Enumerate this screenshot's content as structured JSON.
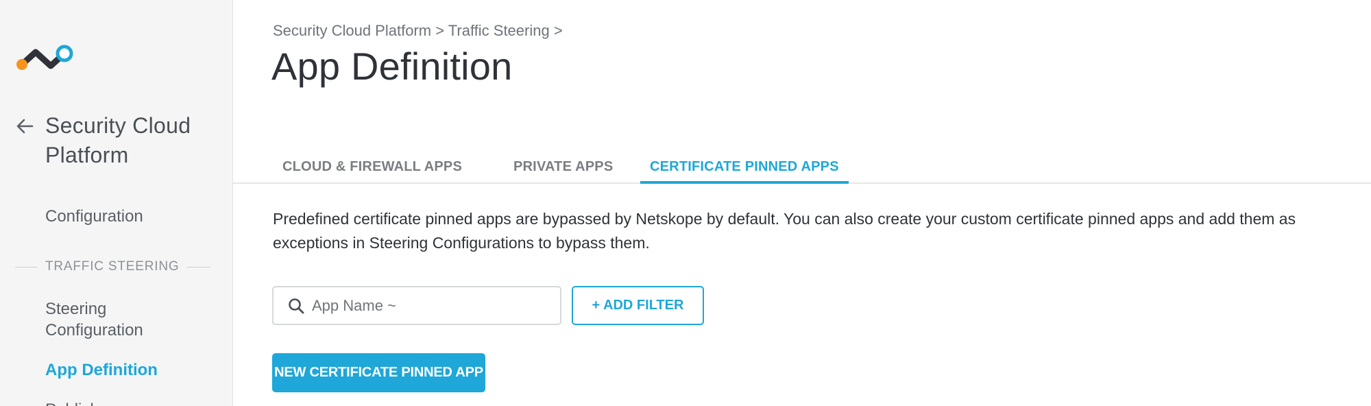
{
  "sidebar": {
    "back_title": "Security Cloud Platform",
    "items": [
      {
        "label": "Configuration"
      },
      {
        "label": "Steering Configuration"
      },
      {
        "label": "App Definition"
      },
      {
        "label": "Publishers"
      }
    ],
    "section_label": "TRAFFIC STEERING",
    "active_item": "App Definition"
  },
  "header": {
    "breadcrumb": "Security Cloud Platform > Traffic Steering >",
    "title": "App Definition"
  },
  "tabs": [
    {
      "label": "CLOUD & FIREWALL APPS",
      "active": false
    },
    {
      "label": "PRIVATE APPS",
      "active": false
    },
    {
      "label": "CERTIFICATE PINNED APPS",
      "active": true
    }
  ],
  "main": {
    "description": "Predefined certificate pinned apps are bypassed by Netskope by default. You can also create your custom certificate pinned apps and add them as exceptions in Steering Configurations to bypass them.",
    "search": {
      "placeholder": "App Name ~",
      "value": ""
    },
    "add_filter_label": "+ ADD FILTER",
    "new_button_label": "NEW CERTIFICATE PINNED APP"
  },
  "colors": {
    "accent": "#1ea7d8",
    "logo_orange": "#f7941d",
    "logo_blue": "#1ea7d8",
    "logo_dark": "#2f3238"
  },
  "icons": [
    "netskope-logo",
    "back-arrow-icon",
    "search-icon"
  ]
}
